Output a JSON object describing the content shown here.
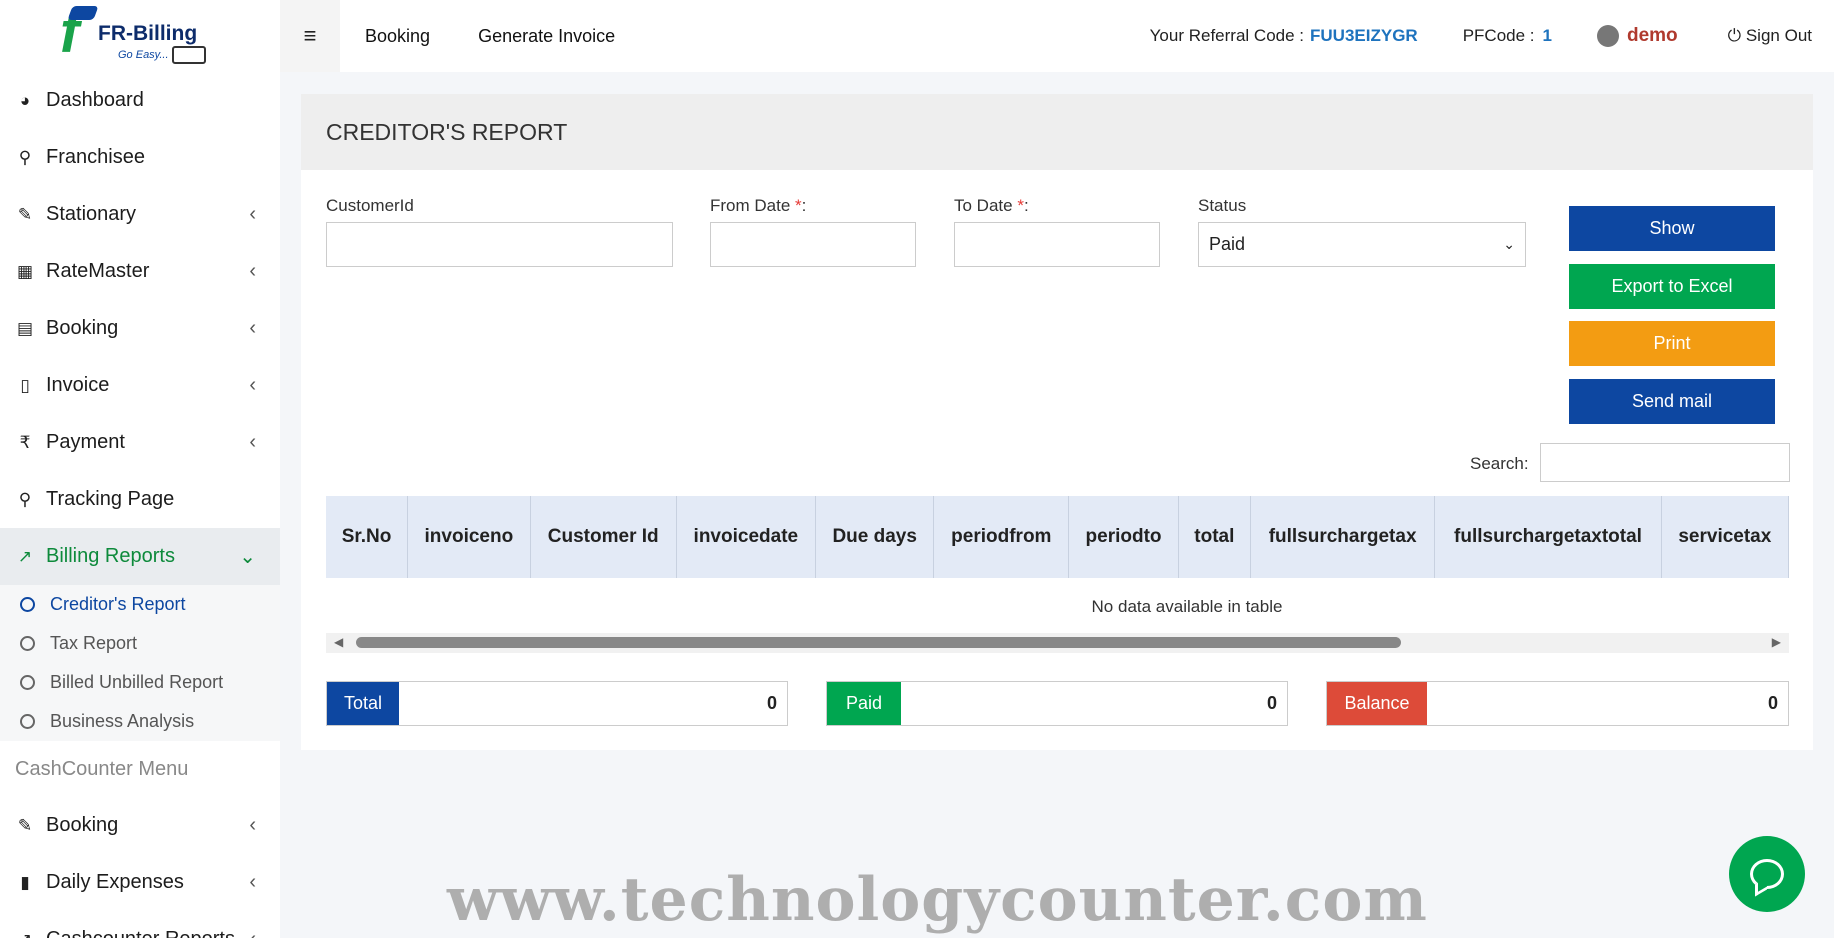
{
  "logo": {
    "brand": "FR-Billing",
    "tagline": "Go Easy..."
  },
  "sidebar": {
    "items": [
      {
        "label": "Dashboard",
        "icon": "dashboard-icon",
        "glyph": "◕",
        "has_chevron": false
      },
      {
        "label": "Franchisee",
        "icon": "map-marker-icon",
        "glyph": "⚲",
        "has_chevron": false
      },
      {
        "label": "Stationary",
        "icon": "edit-icon",
        "glyph": "✎",
        "has_chevron": true
      },
      {
        "label": "RateMaster",
        "icon": "calculator-icon",
        "glyph": "▦",
        "has_chevron": true
      },
      {
        "label": "Booking",
        "icon": "id-card-icon",
        "glyph": "▤",
        "has_chevron": true
      },
      {
        "label": "Invoice",
        "icon": "pdf-file-icon",
        "glyph": "▯",
        "has_chevron": true
      },
      {
        "label": "Payment",
        "icon": "rupee-icon",
        "glyph": "₹",
        "has_chevron": true
      },
      {
        "label": "Tracking Page",
        "icon": "search-icon",
        "glyph": "⚲",
        "has_chevron": false
      },
      {
        "label": "Billing Reports",
        "icon": "line-chart-icon",
        "glyph": "↗",
        "has_chevron": true,
        "active": true
      }
    ],
    "subitems": [
      {
        "label": "Creditor's Report",
        "active": true
      },
      {
        "label": "Tax Report"
      },
      {
        "label": "Billed Unbilled Report"
      },
      {
        "label": "Business Analysis"
      }
    ],
    "cash_header": "CashCounter Menu",
    "cash_items": [
      {
        "label": "Booking",
        "icon": "edit-icon",
        "glyph": "✎"
      },
      {
        "label": "Daily Expenses",
        "icon": "bookmark-icon",
        "glyph": "▮"
      },
      {
        "label": "Cashcounter Reports",
        "icon": "line-chart-icon",
        "glyph": "↗"
      }
    ],
    "chevron_left": "‹",
    "chevron_down": "⌄"
  },
  "topbar": {
    "hamburger": "≡",
    "nav": [
      "Booking",
      "Generate Invoice"
    ],
    "referral_label": "Your Referral Code :",
    "referral_code": "FUU3EIZYGR",
    "pfcode_label": "PFCode :",
    "pfcode": "1",
    "username": "demo",
    "signout": "⏻ Sign Out"
  },
  "report": {
    "title": "CREDITOR'S REPORT",
    "customer_label": "CustomerId",
    "from_label": "From Date",
    "to_label": "To Date",
    "required_mark": "*",
    "colon": ":",
    "status_label": "Status",
    "status_value": "Paid",
    "buttons": {
      "show": "Show",
      "export": "Export to Excel",
      "print": "Print",
      "mail": "Send mail"
    },
    "search_label": "Search:",
    "columns": [
      "Sr.No",
      "invoiceno",
      "Customer Id",
      "invoicedate",
      "Due days",
      "periodfrom",
      "periodto",
      "total",
      "fullsurchargetax",
      "fullsurchargetaxtotal",
      "servicetax"
    ],
    "empty_message": "No data available in table",
    "summary": {
      "total_label": "Total",
      "total_value": "0",
      "paid_label": "Paid",
      "paid_value": "0",
      "balance_label": "Balance",
      "balance_value": "0"
    }
  },
  "watermark": "www.technologycounter.com",
  "colors": {
    "accent_green": "#00a650",
    "brand_blue": "#0d47a1",
    "orange": "#f39c12",
    "red": "#dd4b39"
  }
}
